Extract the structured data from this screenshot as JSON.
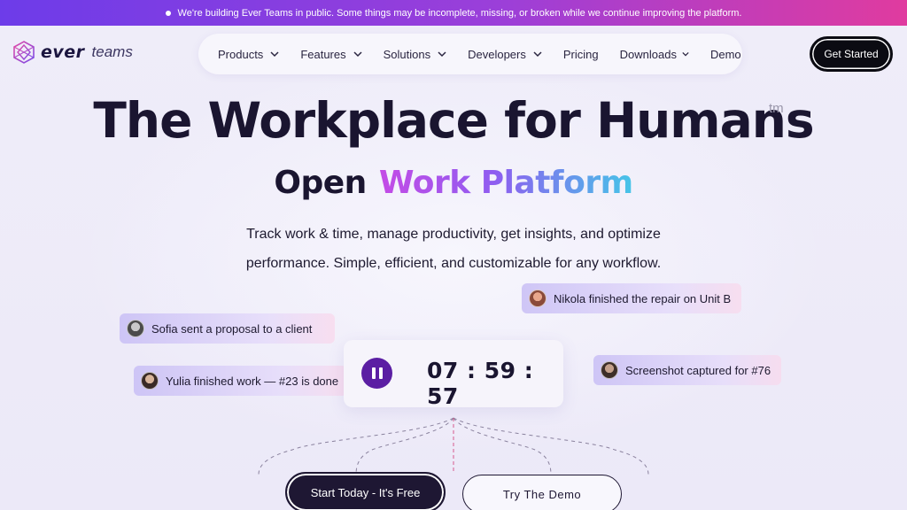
{
  "banner": {
    "text": "We're building Ever Teams in public. Some things may be incomplete, missing, or broken while we continue improving the platform."
  },
  "logo": {
    "word1": "ever",
    "word2": "teams",
    "icon": "ever-logo-icon"
  },
  "nav": {
    "items": [
      {
        "label": "Products",
        "dropdown": true
      },
      {
        "label": "Features",
        "dropdown": true
      },
      {
        "label": "Solutions",
        "dropdown": true
      },
      {
        "label": "Developers",
        "dropdown": true
      },
      {
        "label": "Pricing",
        "dropdown": false
      },
      {
        "label": "Downloads",
        "dropdown": true
      },
      {
        "label": "Demo",
        "dropdown": false
      }
    ],
    "cta_label": "Get Started"
  },
  "hero": {
    "title": "The Workplace for Humans",
    "tm": "tm",
    "subtitle_plain": "Open",
    "subtitle_gradient": "Work Platform",
    "description_line1": "Track work & time, manage productivity, get insights, and optimize",
    "description_line2": "performance. Simple, efficient, and customizable for any workflow."
  },
  "activity": [
    {
      "text": "Nikola finished the repair on Unit B"
    },
    {
      "text": "Sofia sent a proposal to a client"
    },
    {
      "text": "Yulia finished work — #23 is done"
    },
    {
      "text": "Screenshot captured for #76"
    }
  ],
  "timer": {
    "value": "07 : 59 : 57"
  },
  "buttons": {
    "primary": "Start Today - It's Free",
    "secondary": "Try The Demo"
  },
  "colors": {
    "accent": "#5b1ea3",
    "banner_start": "#6d3ce9",
    "banner_end": "#e03b9f",
    "dark": "#0b0b12"
  }
}
